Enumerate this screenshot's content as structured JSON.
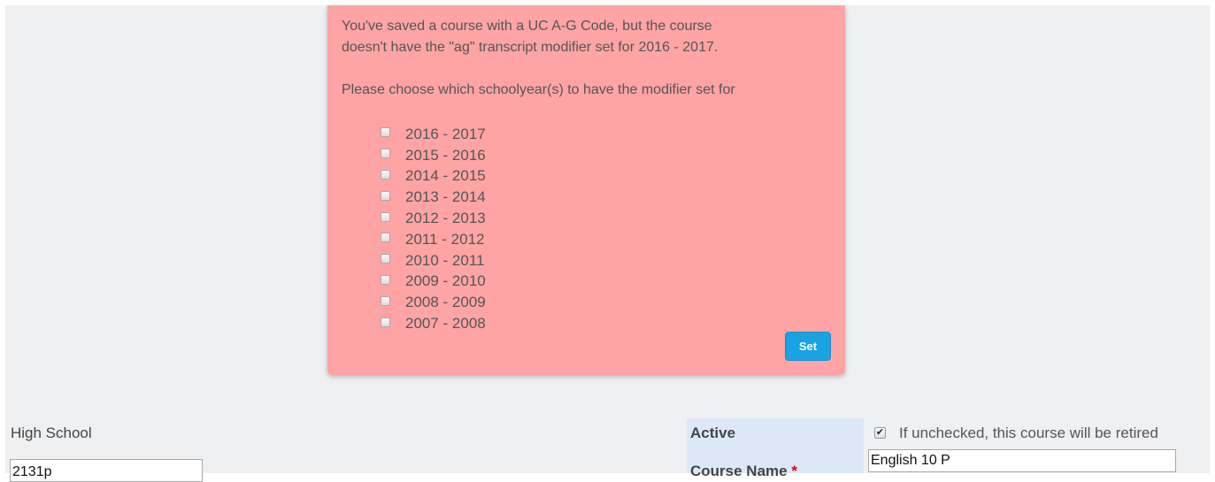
{
  "modal": {
    "message_line1": "You've saved a course with a UC A-G Code, but the course",
    "message_line2": "doesn't have the \"ag\" transcript modifier set for 2016 - 2017.",
    "prompt": "Please choose which schoolyear(s) to have the modifier set for",
    "years": [
      {
        "label": "2016 - 2017",
        "checked": false
      },
      {
        "label": "2015 - 2016",
        "checked": false
      },
      {
        "label": "2014 - 2015",
        "checked": false
      },
      {
        "label": "2013 - 2014",
        "checked": false
      },
      {
        "label": "2012 - 2013",
        "checked": false
      },
      {
        "label": "2011 - 2012",
        "checked": false
      },
      {
        "label": "2010 - 2011",
        "checked": false
      },
      {
        "label": "2009 - 2010",
        "checked": false
      },
      {
        "label": "2008 - 2009",
        "checked": false
      },
      {
        "label": "2007 - 2008",
        "checked": false
      }
    ],
    "set_label": "Set",
    "background_color": "#ffa4a4",
    "button_color": "#1aa3e3"
  },
  "form": {
    "high_school_label": "High School",
    "course_code_value": "2131p",
    "active_label": "Active",
    "active_checked": true,
    "active_hint": "If unchecked, this course will be retired",
    "course_name_label": "Course Name",
    "required_marker": "*",
    "course_name_value": "English 10 P"
  }
}
